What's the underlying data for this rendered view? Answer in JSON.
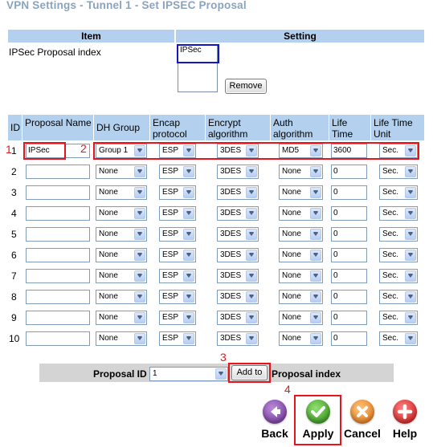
{
  "page": {
    "title": "VPN Settings - Tunnel 1 - Set IPSEC Proposal"
  },
  "summary": {
    "col_item": "Item",
    "col_setting": "Setting",
    "row_label": "IPSec Proposal index",
    "listbox_items": [
      "IPSec"
    ],
    "remove_label": "Remove"
  },
  "table": {
    "headers": {
      "id": "ID",
      "name": "Proposal Name",
      "dh": "DH Group",
      "encap": "Encap protocol",
      "encrypt": "Encrypt algorithm",
      "auth": "Auth algorithm",
      "life": "Life Time",
      "unit": "Life Time Unit"
    },
    "rows": [
      {
        "id": "1",
        "name": "IPSec",
        "dh": "Group 1",
        "encap": "ESP",
        "encrypt": "3DES",
        "auth": "MD5",
        "life": "3600",
        "unit": "Sec."
      },
      {
        "id": "2",
        "name": "",
        "dh": "None",
        "encap": "ESP",
        "encrypt": "3DES",
        "auth": "None",
        "life": "0",
        "unit": "Sec."
      },
      {
        "id": "3",
        "name": "",
        "dh": "None",
        "encap": "ESP",
        "encrypt": "3DES",
        "auth": "None",
        "life": "0",
        "unit": "Sec."
      },
      {
        "id": "4",
        "name": "",
        "dh": "None",
        "encap": "ESP",
        "encrypt": "3DES",
        "auth": "None",
        "life": "0",
        "unit": "Sec."
      },
      {
        "id": "5",
        "name": "",
        "dh": "None",
        "encap": "ESP",
        "encrypt": "3DES",
        "auth": "None",
        "life": "0",
        "unit": "Sec."
      },
      {
        "id": "6",
        "name": "",
        "dh": "None",
        "encap": "ESP",
        "encrypt": "3DES",
        "auth": "None",
        "life": "0",
        "unit": "Sec."
      },
      {
        "id": "7",
        "name": "",
        "dh": "None",
        "encap": "ESP",
        "encrypt": "3DES",
        "auth": "None",
        "life": "0",
        "unit": "Sec."
      },
      {
        "id": "8",
        "name": "",
        "dh": "None",
        "encap": "ESP",
        "encrypt": "3DES",
        "auth": "None",
        "life": "0",
        "unit": "Sec."
      },
      {
        "id": "9",
        "name": "",
        "dh": "None",
        "encap": "ESP",
        "encrypt": "3DES",
        "auth": "None",
        "life": "0",
        "unit": "Sec."
      },
      {
        "id": "10",
        "name": "",
        "dh": "None",
        "encap": "ESP",
        "encrypt": "3DES",
        "auth": "None",
        "life": "0",
        "unit": "Sec."
      }
    ]
  },
  "add_bar": {
    "proposal_id_label": "Proposal ID",
    "proposal_id_value": "1",
    "add_label": "Add to",
    "after_label": "Proposal index"
  },
  "annotations": {
    "step1": "1",
    "step2": "2",
    "step3": "3",
    "step4": "4"
  },
  "actions": {
    "back": {
      "label": "Back",
      "icon": "arrow-left-icon",
      "color": "#7b3fa0"
    },
    "apply": {
      "label": "Apply",
      "icon": "checkmark-icon",
      "color": "#3a9a1e"
    },
    "cancel": {
      "label": "Cancel",
      "icon": "x-icon",
      "color": "#e8811c"
    },
    "help": {
      "label": "Help",
      "icon": "plus-icon",
      "color": "#d81c1c"
    }
  },
  "colors": {
    "header_bg": "#b3d1ee",
    "highlight_red": "#e8141c",
    "highlight_blue": "#1515c8",
    "title": "#8aa3bc"
  }
}
